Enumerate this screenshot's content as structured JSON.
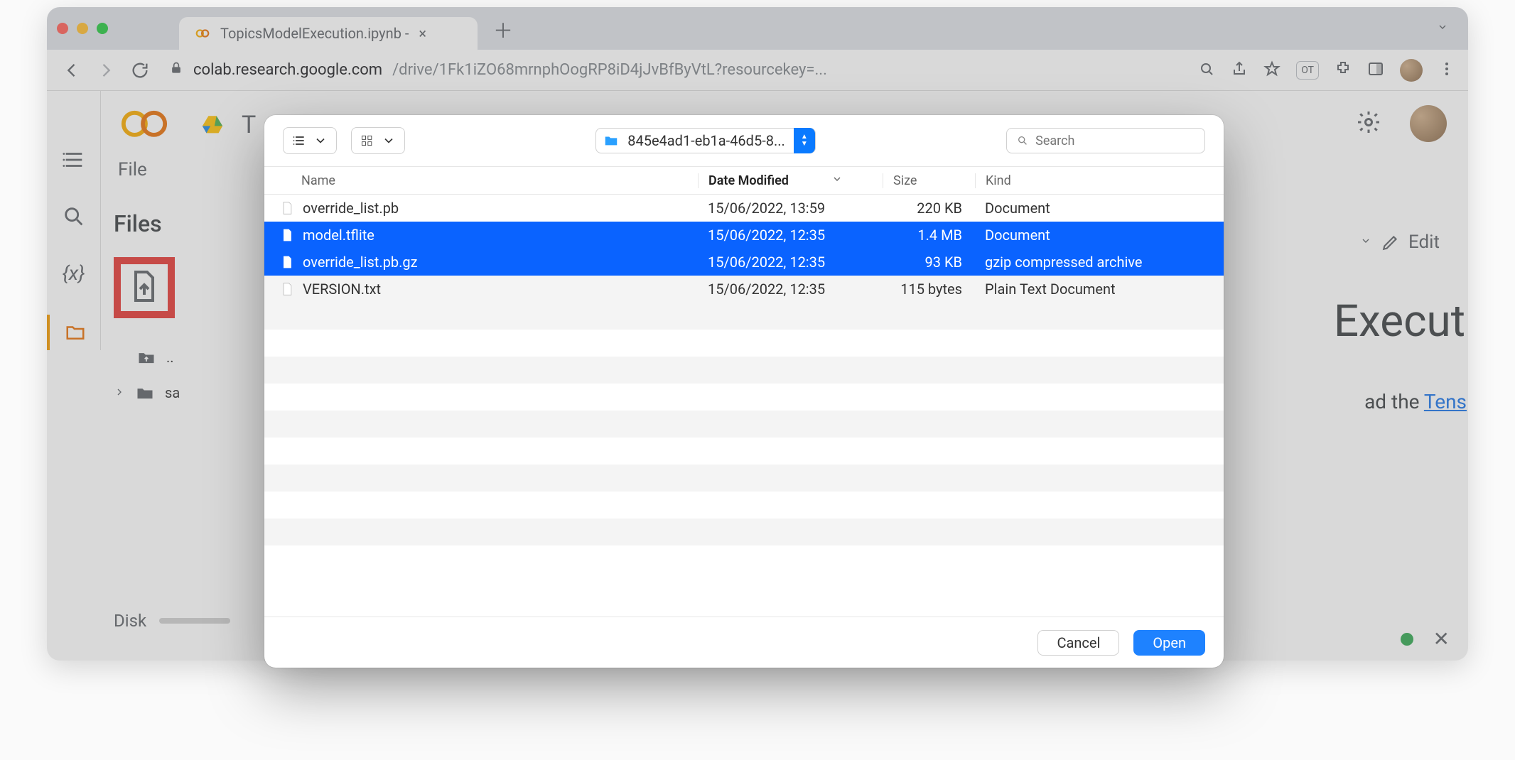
{
  "browser": {
    "tab_title": "TopicsModelExecution.ipynb -",
    "url_host": "colab.research.google.com",
    "url_path": "/drive/1Fk1iZO68mrnphOogRP8iD4jJvBfByVtL?resourcekey=...",
    "profile_initials": "OT"
  },
  "colab": {
    "menu_file": "File",
    "doc_title_visible": " Execut",
    "doc_line_visible": "ad the ",
    "doc_link_partial": "Tens",
    "edit_label": "Edit",
    "files_heading": "Files",
    "tree_up": "..",
    "tree_sa": "sa",
    "disk_label": "Disk"
  },
  "dialog": {
    "folder_name": "845e4ad1-eb1a-46d5-8...",
    "search_placeholder": "Search",
    "columns": {
      "name": "Name",
      "date": "Date Modified",
      "size": "Size",
      "kind": "Kind"
    },
    "rows": [
      {
        "name": "override_list.pb",
        "date": "15/06/2022, 13:59",
        "size": "220 KB",
        "kind": "Document",
        "selected": false
      },
      {
        "name": "model.tflite",
        "date": "15/06/2022, 12:35",
        "size": "1.4 MB",
        "kind": "Document",
        "selected": true
      },
      {
        "name": "override_list.pb.gz",
        "date": "15/06/2022, 12:35",
        "size": "93 KB",
        "kind": "gzip compressed archive",
        "selected": true
      },
      {
        "name": "VERSION.txt",
        "date": "15/06/2022, 12:35",
        "size": "115 bytes",
        "kind": "Plain Text Document",
        "selected": false
      }
    ],
    "cancel": "Cancel",
    "open": "Open"
  }
}
